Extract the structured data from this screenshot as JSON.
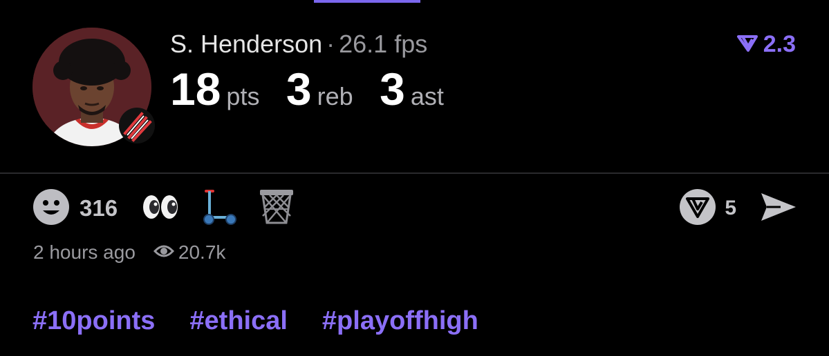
{
  "header": {
    "player_name": "S. Henderson",
    "separator": "·",
    "fps": "26.1 fps",
    "rating": "2.3",
    "rating_icon": "rating-chevron-icon"
  },
  "stats": [
    {
      "value": "18",
      "unit": "pts"
    },
    {
      "value": "3",
      "unit": "reb"
    },
    {
      "value": "3",
      "unit": "ast"
    }
  ],
  "reactions": {
    "smiley_count": "316",
    "emojis": [
      "eyes-emoji",
      "scooter-emoji",
      "basketball-net-emoji"
    ]
  },
  "actions": {
    "share_count": "5",
    "share_icon": "send-icon"
  },
  "meta": {
    "timestamp": "2 hours ago",
    "views": "20.7k"
  },
  "hashtags": [
    "#10points",
    "#ethical",
    "#playoffhigh"
  ],
  "colors": {
    "accent": "#8b6ff7",
    "background": "#000000",
    "team_red": "#e03a3e"
  }
}
